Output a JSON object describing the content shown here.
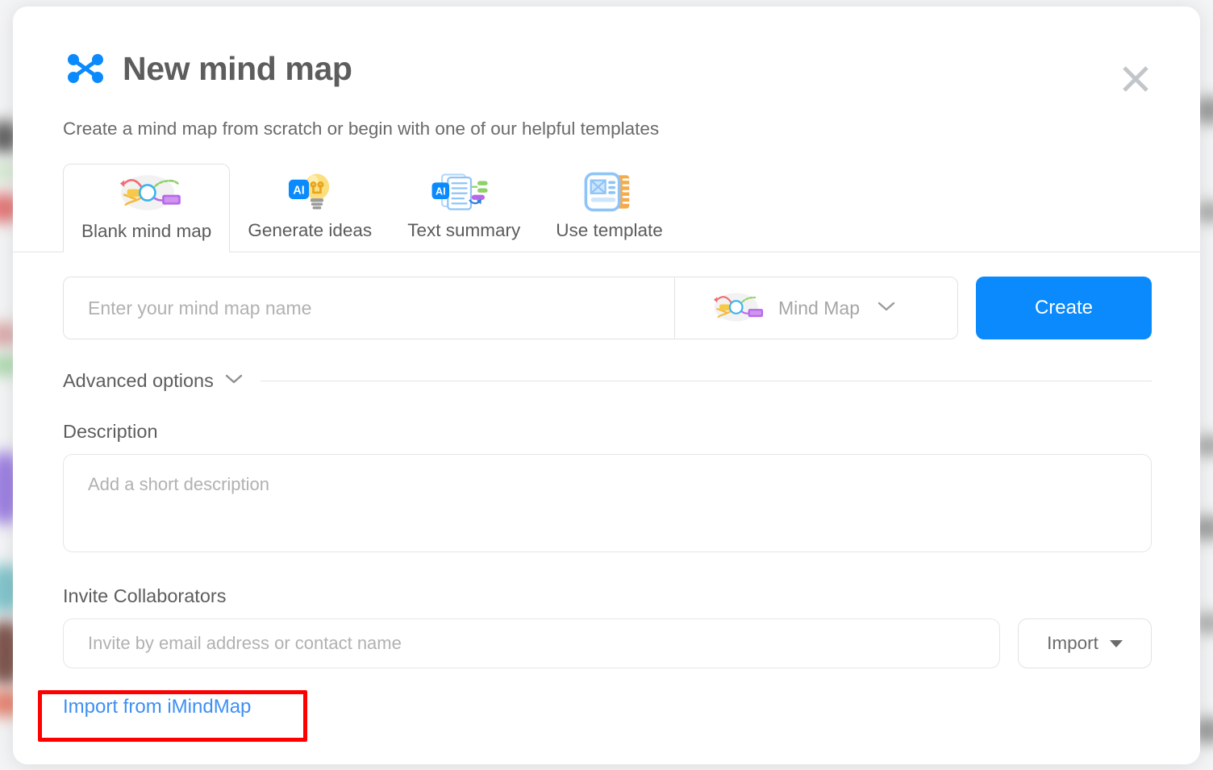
{
  "modal": {
    "brand_icon": "mindmeister-nodes-icon",
    "title": "New mind map",
    "close_icon": "close-icon",
    "subtitle": "Create a mind map from scratch or begin with one of our helpful templates"
  },
  "tabs": [
    {
      "label": "Blank mind map",
      "icon": "mind-map-sketch-icon",
      "active": true
    },
    {
      "label": "Generate ideas",
      "icon": "ai-lightbulb-icon",
      "active": false
    },
    {
      "label": "Text summary",
      "icon": "ai-document-branches-icon",
      "active": false
    },
    {
      "label": "Use template",
      "icon": "template-ruler-icon",
      "active": false
    }
  ],
  "form": {
    "name_placeholder": "Enter your mind map name",
    "name_value": "",
    "type_icon": "mind-map-sketch-icon",
    "type_value": "Mind Map",
    "type_chevron_icon": "chevron-down-icon",
    "create_label": "Create"
  },
  "advanced": {
    "label": "Advanced options",
    "chevron_icon": "chevron-down-icon"
  },
  "description": {
    "label": "Description",
    "placeholder": "Add a short description",
    "value": ""
  },
  "collaborators": {
    "label": "Invite Collaborators",
    "placeholder": "Invite by email address or contact name",
    "value": "",
    "import_label": "Import",
    "import_caret_icon": "caret-down-icon"
  },
  "footer": {
    "import_link_label": "Import from iMindMap"
  },
  "colors": {
    "accent_blue": "#0a8afc",
    "link_blue": "#3d8ff5",
    "highlight_red": "#fe0000",
    "text_gray": "#5d5d5d",
    "placeholder_gray": "#b1b1b1",
    "border_gray": "#e2e2e2"
  }
}
